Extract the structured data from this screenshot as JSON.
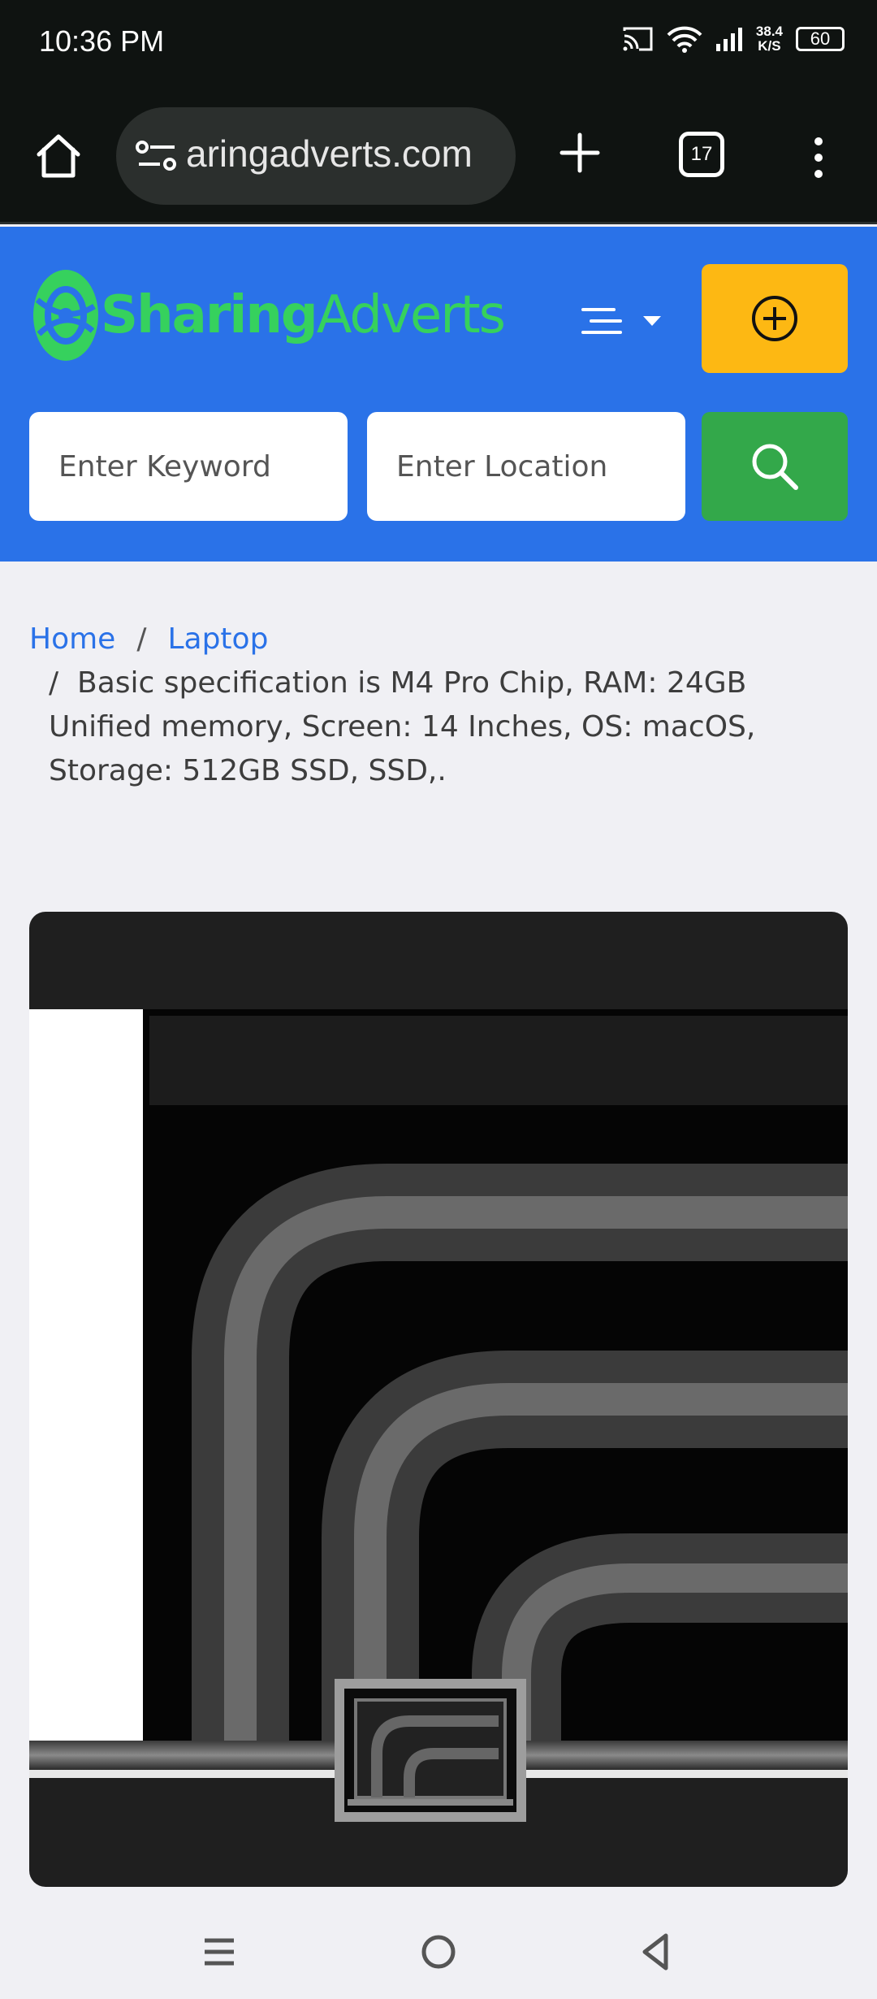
{
  "status_bar": {
    "time": "10:36 PM",
    "net_speed_value": "38.4",
    "net_speed_unit": "K/S",
    "battery": "60"
  },
  "browser": {
    "url": "aringadverts.com",
    "tab_count": "17"
  },
  "site": {
    "logo_bold": "Sharing",
    "logo_light": "Adverts",
    "brand_color": "#2a72e8",
    "accent_color": "#fdb813",
    "search_color": "#33a84a"
  },
  "search": {
    "keyword_placeholder": "Enter Keyword",
    "location_placeholder": "Enter Location"
  },
  "breadcrumb": {
    "home": "Home",
    "category": "Laptop",
    "current": "Basic specification is M4 Pro Chip, RAM: 24GB Unified memory, Screen: 14 Inches, OS: macOS, Storage: 512GB SSD, SSD,."
  }
}
